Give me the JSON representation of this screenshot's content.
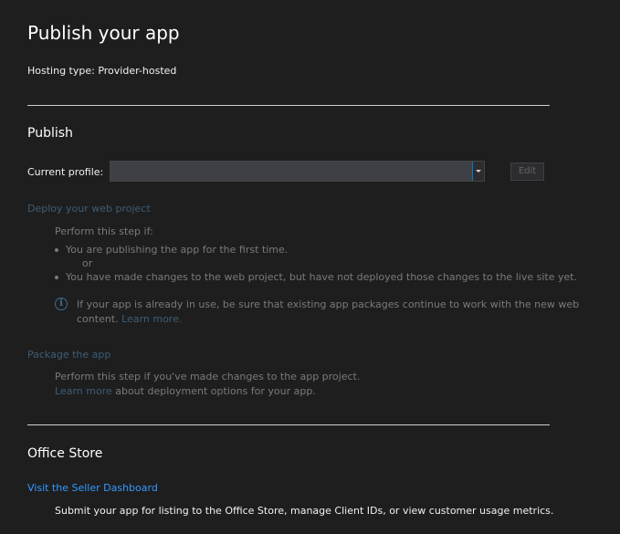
{
  "page": {
    "title": "Publish your app",
    "hosting": "Hosting type: Provider-hosted"
  },
  "publish": {
    "heading": "Publish",
    "profile_label": "Current profile:",
    "profile_value": "",
    "edit_label": "Edit",
    "deploy": {
      "link": "Deploy your web project",
      "intro": "Perform this step if:",
      "bullet1": "You are publishing the app for the first time.",
      "or": "or",
      "bullet2": "You have made changes to the web project, but have not deployed those changes to the live site yet.",
      "info_line1": "If your app is already in use, be sure that existing app packages continue to work with the new web",
      "info_line2": "content.",
      "info_link": "Learn more."
    },
    "package": {
      "link": "Package the app",
      "line1": "Perform this step if you've made changes to the app project.",
      "learn_link": "Learn more",
      "line2_rest": " about deployment options for your app."
    }
  },
  "store": {
    "heading": "Office Store",
    "link": "Visit the Seller Dashboard",
    "description": "Submit your app for listing to the Office Store, manage Client IDs, or view customer usage metrics."
  },
  "colors": {
    "background": "#1e1e1e",
    "link_active": "#3399ff",
    "link_disabled": "#3d5d77",
    "text_disabled": "#7a7a7a"
  }
}
